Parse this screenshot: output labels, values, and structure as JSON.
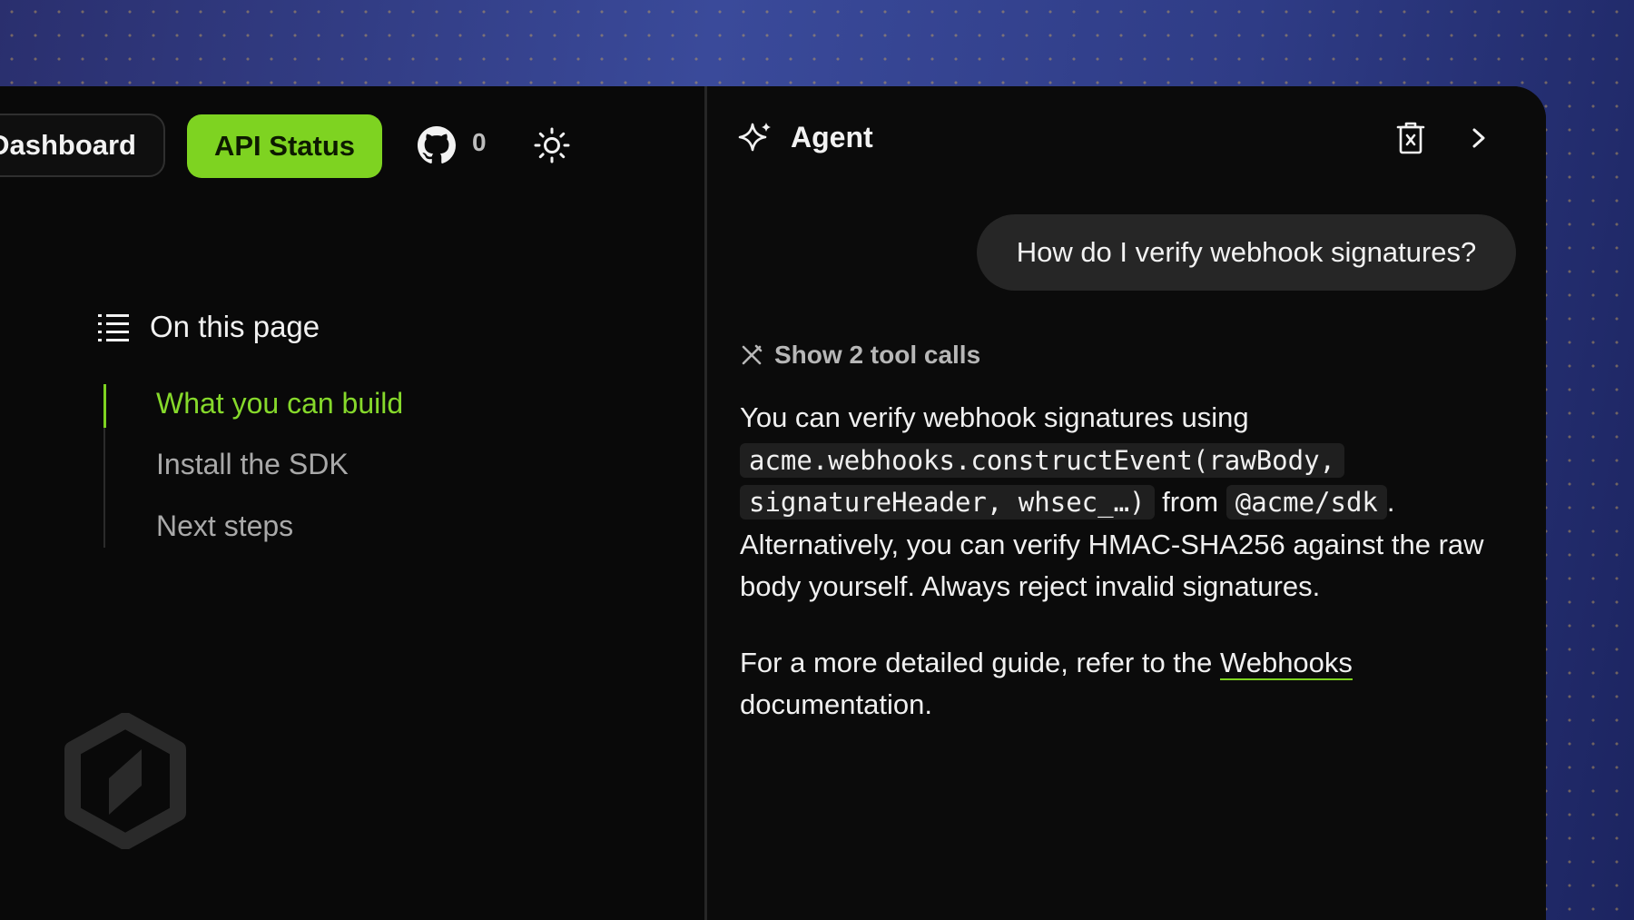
{
  "nav": {
    "dashboard_label": "Dashboard",
    "api_status_label": "API Status",
    "github_icon": "github-icon",
    "github_count": "0",
    "theme_icon": "sun-icon"
  },
  "toc": {
    "title": "On this page",
    "items": [
      {
        "label": "What you can build",
        "active": true
      },
      {
        "label": "Install the SDK",
        "active": false
      },
      {
        "label": "Next steps",
        "active": false
      }
    ]
  },
  "agent": {
    "title": "Agent",
    "user_message": "How do I verify webhook signatures?",
    "tool_calls_label": "Show 2 tool calls",
    "answer": {
      "p1_text1": "You can verify webhook signatures using ",
      "p1_code1": "acme.webhooks.constructEvent(rawBody, signatureHeader, whsec_…)",
      "p1_text2": " from ",
      "p1_code2": "@acme/sdk",
      "p1_text3": ". Alternatively, you can verify HMAC-SHA256 against the raw body yourself. Always reject invalid signatures.",
      "p2_text1": "For a more detailed guide, refer to the ",
      "p2_link": "Webhooks",
      "p2_text2": " documentation."
    }
  },
  "colors": {
    "accent": "#7ed321",
    "background": "#090909",
    "bubble": "#262626"
  }
}
